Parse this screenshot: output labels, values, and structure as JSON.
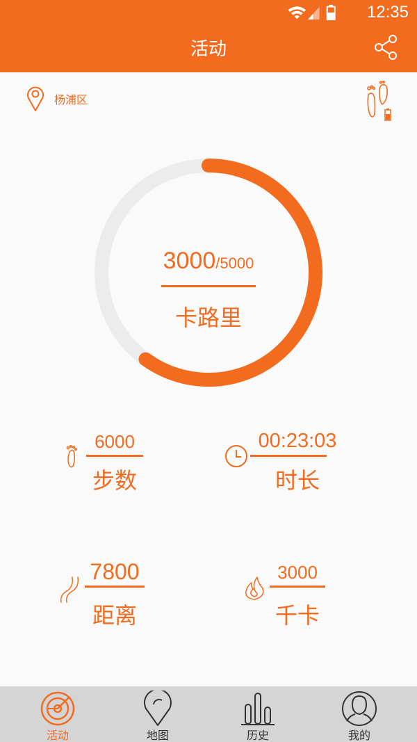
{
  "status_bar": {
    "time": "12:35"
  },
  "app_bar": {
    "title": "活动"
  },
  "location": {
    "label": "杨浦区"
  },
  "ring": {
    "current": "3000",
    "goal": "/5000",
    "label": "卡路里",
    "progress": 0.6
  },
  "stats": [
    {
      "value": "6000",
      "label": "步数",
      "icon": "footprint-icon"
    },
    {
      "value": "00:23:03",
      "label": "时长",
      "icon": "clock-icon"
    },
    {
      "value": "7800",
      "label": "距离",
      "icon": "path-icon"
    },
    {
      "value": "3000",
      "label": "千卡",
      "icon": "flame-icon"
    }
  ],
  "nav": [
    {
      "label": "活动",
      "icon": "radar-icon",
      "active": true
    },
    {
      "label": "地图",
      "icon": "map-pin-icon",
      "active": false
    },
    {
      "label": "历史",
      "icon": "bar-chart-icon",
      "active": false
    },
    {
      "label": "我的",
      "icon": "profile-icon",
      "active": false
    }
  ],
  "colors": {
    "accent": "#f26b1f",
    "track": "#ececec",
    "nav_bg": "#d5d5d5"
  }
}
